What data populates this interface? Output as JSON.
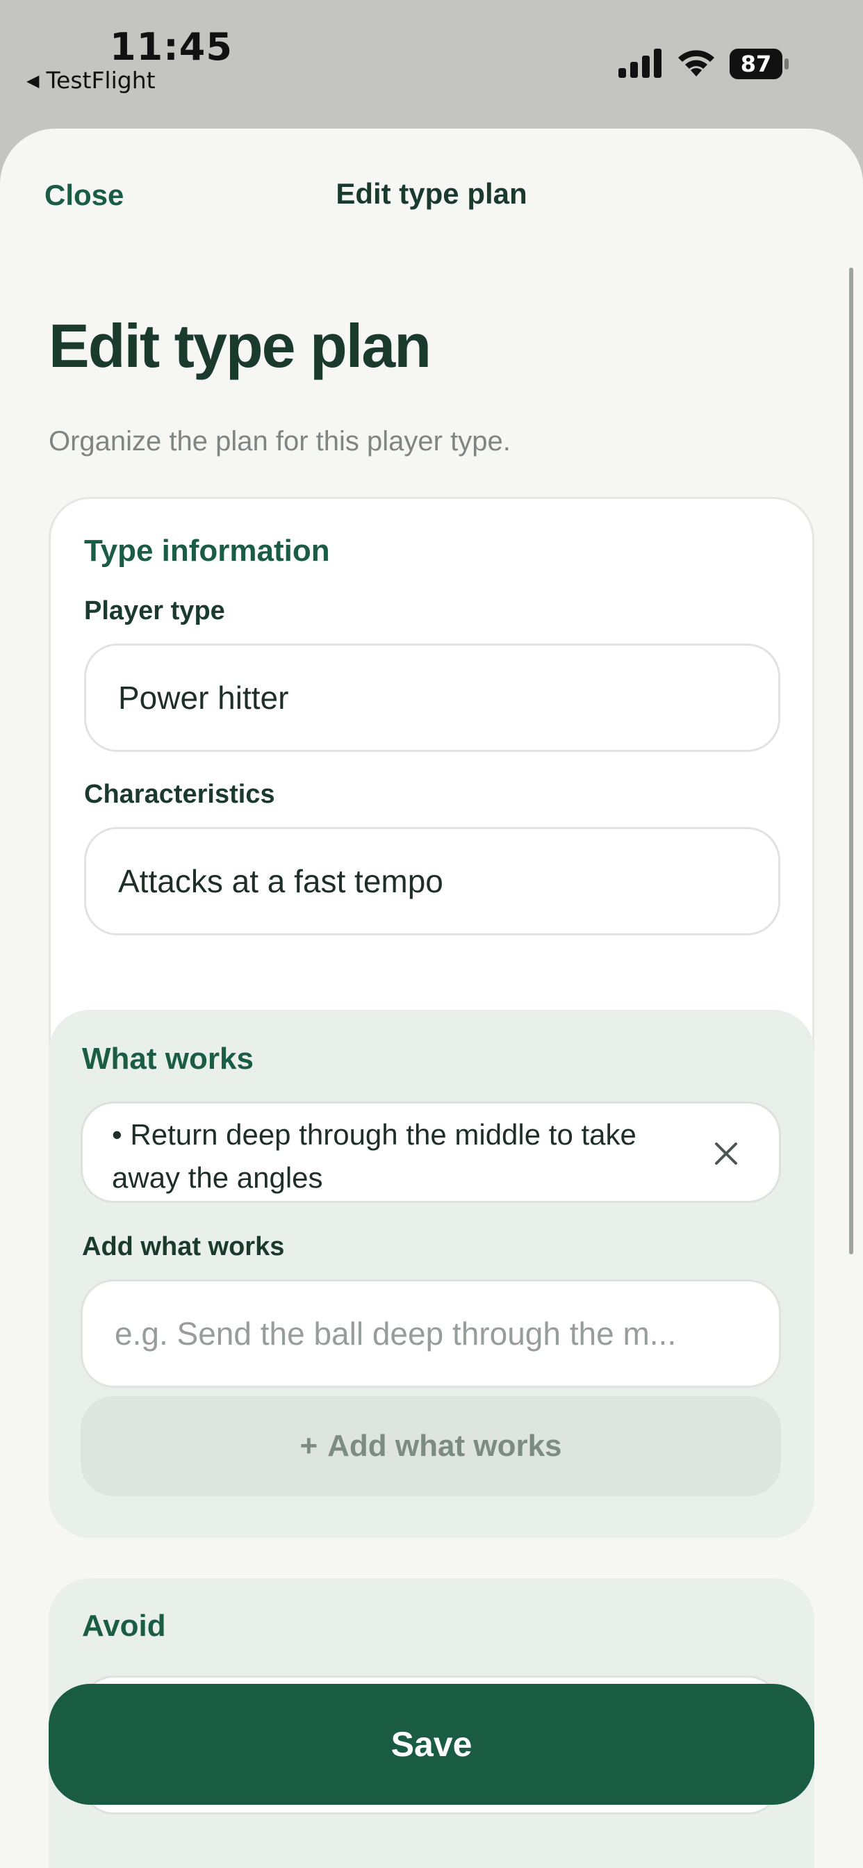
{
  "status_bar": {
    "time": "11:45",
    "back_app": "TestFlight",
    "battery": "87"
  },
  "nav": {
    "close_label": "Close",
    "title": "Edit type plan"
  },
  "header": {
    "heading": "Edit type plan",
    "subtitle": "Organize the plan for this player type."
  },
  "type_information": {
    "section_title": "Type information",
    "player_type_label": "Player type",
    "player_type_value": "Power hitter",
    "characteristics_label": "Characteristics",
    "characteristics_value": "Attacks at a fast tempo"
  },
  "what_works": {
    "section_title": "What works",
    "items": [
      {
        "text": "• Return deep through the middle to take away the angles"
      }
    ],
    "add_label": "Add what works",
    "add_placeholder": "e.g. Send the ball deep through the m...",
    "add_button_label": "Add what works"
  },
  "avoid": {
    "section_title": "Avoid"
  },
  "save_label": "Save",
  "colors": {
    "accent": "#1a5c45",
    "heading": "#1a3a2d",
    "sheet_bg": "#f6f7f4",
    "section_bg": "#e9efea"
  }
}
